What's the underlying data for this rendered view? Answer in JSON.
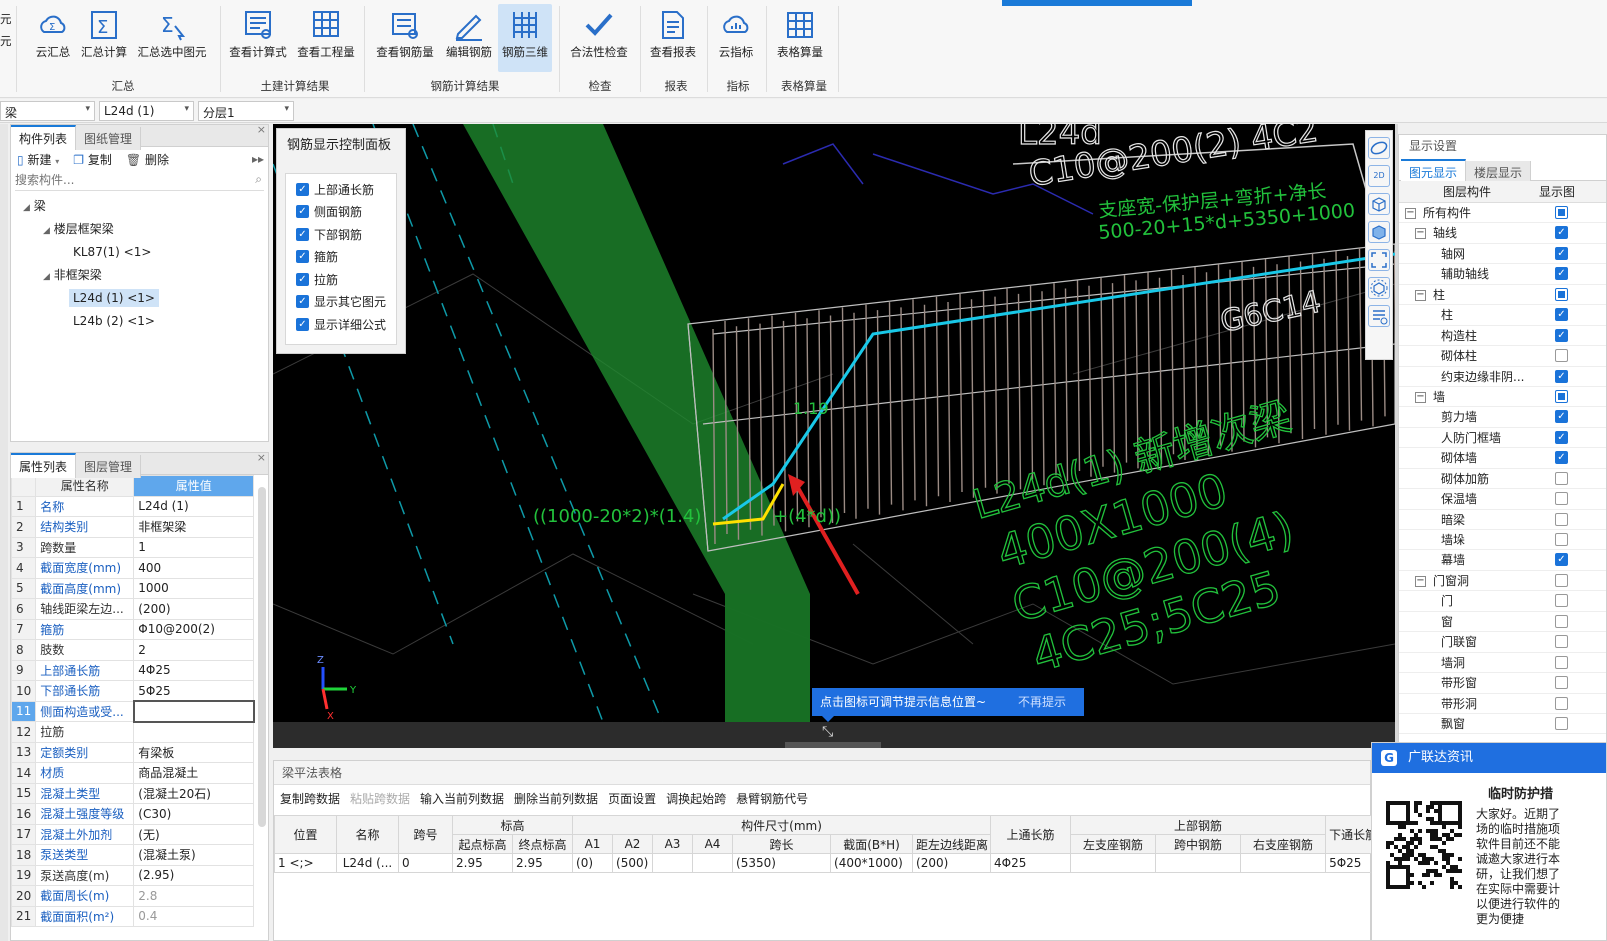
{
  "ribbon": {
    "left_cut": [
      "元",
      "元"
    ],
    "buttons": [
      {
        "label": "云汇总",
        "icon": "cloud-sum-icon"
      },
      {
        "label": "汇总计算",
        "icon": "sigma-icon"
      },
      {
        "label": "汇总选中图元",
        "icon": "sigma-select-icon"
      },
      {
        "label": "查看计算式",
        "icon": "view-formula-icon"
      },
      {
        "label": "查看工程量",
        "icon": "view-quantity-icon"
      },
      {
        "label": "查看钢筋量",
        "icon": "view-rebar-icon"
      },
      {
        "label": "编辑钢筋",
        "icon": "edit-rebar-icon"
      },
      {
        "label": "钢筋三维",
        "icon": "rebar-3d-icon"
      },
      {
        "label": "合法性检查",
        "icon": "check-icon"
      },
      {
        "label": "查看报表",
        "icon": "report-icon"
      },
      {
        "label": "云指标",
        "icon": "cloud-index-icon"
      },
      {
        "label": "表格算量",
        "icon": "table-calc-icon"
      }
    ],
    "groups": [
      "汇总",
      "土建计算结果",
      "钢筋计算结果",
      "检查",
      "报表",
      "指标",
      "表格算量"
    ]
  },
  "selectors": {
    "type": "梁",
    "name": "L24d (1)",
    "floor": "分层1"
  },
  "component_panel": {
    "tabs": [
      "构件列表",
      "图纸管理"
    ],
    "toolbar": {
      "new": "新建",
      "copy": "复制",
      "delete": "删除"
    },
    "search_placeholder": "搜索构件...",
    "tree": {
      "root": "梁",
      "group1": "楼层框架梁",
      "item1": "KL87(1) <1>",
      "group2": "非框架梁",
      "item2": "L24d (1)  <1>",
      "item3": "L24b (2) <1>"
    }
  },
  "property_panel": {
    "tabs": [
      "属性列表",
      "图层管理"
    ],
    "col_name": "属性名称",
    "col_value": "属性值",
    "rows": [
      {
        "n": "1",
        "k": "名称",
        "v": "L24d  (1)"
      },
      {
        "n": "2",
        "k": "结构类别",
        "v": "非框架梁"
      },
      {
        "n": "3",
        "k": "跨数量",
        "v": "1"
      },
      {
        "n": "4",
        "k": "截面宽度(mm)",
        "v": "400"
      },
      {
        "n": "5",
        "k": "截面高度(mm)",
        "v": "1000"
      },
      {
        "n": "6",
        "k": "轴线距梁左边...",
        "v": "(200)"
      },
      {
        "n": "7",
        "k": "箍筋",
        "v": "Φ10@200(2)"
      },
      {
        "n": "8",
        "k": "肢数",
        "v": "2"
      },
      {
        "n": "9",
        "k": "上部通长筋",
        "v": "4Φ25"
      },
      {
        "n": "10",
        "k": "下部通长筋",
        "v": "5Φ25"
      },
      {
        "n": "11",
        "k": "侧面构造或受...",
        "v": ""
      },
      {
        "n": "12",
        "k": "拉筋",
        "v": ""
      },
      {
        "n": "13",
        "k": "定额类别",
        "v": "有梁板"
      },
      {
        "n": "14",
        "k": "材质",
        "v": "商品混凝土"
      },
      {
        "n": "15",
        "k": "混凝土类型",
        "v": "(混凝土20石)"
      },
      {
        "n": "16",
        "k": "混凝土强度等级",
        "v": "(C30)"
      },
      {
        "n": "17",
        "k": "混凝土外加剂",
        "v": "(无)"
      },
      {
        "n": "18",
        "k": "泵送类型",
        "v": "(混凝土泵)"
      },
      {
        "n": "19",
        "k": "泵送高度(m)",
        "v": "(2.95)"
      },
      {
        "n": "20",
        "k": "截面周长(m)",
        "v": "2.8"
      },
      {
        "n": "21",
        "k": "截面面积(m²)",
        "v": "0.4"
      }
    ]
  },
  "rebar_control": {
    "title": "钢筋显示控制面板",
    "items": [
      "上部通长筋",
      "侧面钢筋",
      "下部钢筋",
      "箍筋",
      "拉筋",
      "显示其它图元",
      "显示详细公式"
    ]
  },
  "viewport": {
    "t1": "L24d",
    "t2": "C10@200(2) 4C2",
    "t3": "支座宽-保护层+弯折+净长",
    "t4": "500-20+15*d+5350+1000",
    "t5": "G6C14",
    "t6": "L24d(1) 新增次梁",
    "t7": "400X1000",
    "t8": "C10@200(4)",
    "t9": "4C25;5C25",
    "t10": "((1000-20*2)*(1.4)",
    "t11": "+(4*d))",
    "t12": "1.19",
    "accent_cyan": "#19c8e8",
    "accent_green": "#22c13c"
  },
  "tip": {
    "text": "点击图标可调节提示信息位置~",
    "dismiss": "不再提示"
  },
  "grid": {
    "title": "梁平法表格",
    "toolbar": [
      "复制跨数据",
      "粘贴跨数据",
      "输入当前列数据",
      "删除当前列数据",
      "页面设置",
      "调换起始跨",
      "悬臂钢筋代号"
    ],
    "h": {
      "pos": "位置",
      "name": "名称",
      "span": "跨号",
      "elev": "标高",
      "start": "起点标高",
      "end": "终点标高",
      "size": "构件尺寸(mm)",
      "a1": "A1",
      "a2": "A2",
      "a3": "A3",
      "a4": "A4",
      "spanlen": "跨长",
      "sect": "截面(B*H)",
      "left": "距左边线距离",
      "top_cont": "上通长筋",
      "top_rebar": "上部钢筋",
      "left_sup": "左支座钢筋",
      "mid": "跨中钢筋",
      "right_sup": "右支座钢筋",
      "bot_cont": "下通长筋"
    },
    "row": {
      "idx": "1",
      "pos": "<;>",
      "name": "L24d (...",
      "span": "0",
      "start": "2.95",
      "end": "2.95",
      "a1": "(0)",
      "a2": "(500)",
      "a3": "",
      "a4": "",
      "spanlen": "(5350)",
      "sect": "(400*1000)",
      "left": "(200)",
      "top_cont": "4Φ25",
      "left_sup": "",
      "mid": "",
      "right_sup": "",
      "bot_cont": "5Φ25"
    }
  },
  "display_settings": {
    "title": "显示设置",
    "tabs": [
      "图元显示",
      "楼层显示"
    ],
    "col1": "图层构件",
    "col2": "显示图",
    "rows": [
      {
        "label": "所有构件",
        "lvl": 0,
        "exp": "−",
        "st": "part"
      },
      {
        "label": "轴线",
        "lvl": 1,
        "exp": "−",
        "st": "on"
      },
      {
        "label": "轴网",
        "lvl": 2,
        "st": "on"
      },
      {
        "label": "辅助轴线",
        "lvl": 2,
        "st": "on"
      },
      {
        "label": "柱",
        "lvl": 1,
        "exp": "−",
        "st": "part"
      },
      {
        "label": "柱",
        "lvl": 2,
        "st": "on"
      },
      {
        "label": "构造柱",
        "lvl": 2,
        "st": "on"
      },
      {
        "label": "砌体柱",
        "lvl": 2,
        "st": "off"
      },
      {
        "label": "约束边缘非阴...",
        "lvl": 2,
        "st": "on"
      },
      {
        "label": "墙",
        "lvl": 1,
        "exp": "−",
        "st": "part"
      },
      {
        "label": "剪力墙",
        "lvl": 2,
        "st": "on"
      },
      {
        "label": "人防门框墙",
        "lvl": 2,
        "st": "on"
      },
      {
        "label": "砌体墙",
        "lvl": 2,
        "st": "on"
      },
      {
        "label": "砌体加筋",
        "lvl": 2,
        "st": "off"
      },
      {
        "label": "保温墙",
        "lvl": 2,
        "st": "off"
      },
      {
        "label": "暗梁",
        "lvl": 2,
        "st": "off"
      },
      {
        "label": "墙垛",
        "lvl": 2,
        "st": "off"
      },
      {
        "label": "幕墙",
        "lvl": 2,
        "st": "on"
      },
      {
        "label": "门窗洞",
        "lvl": 1,
        "exp": "−",
        "st": "off"
      },
      {
        "label": "门",
        "lvl": 2,
        "st": "off"
      },
      {
        "label": "窗",
        "lvl": 2,
        "st": "off"
      },
      {
        "label": "门联窗",
        "lvl": 2,
        "st": "off"
      },
      {
        "label": "墙洞",
        "lvl": 2,
        "st": "off"
      },
      {
        "label": "带形窗",
        "lvl": 2,
        "st": "off"
      },
      {
        "label": "带形洞",
        "lvl": 2,
        "st": "off"
      },
      {
        "label": "飘窗",
        "lvl": 2,
        "st": "off"
      }
    ]
  },
  "news": {
    "title": "广联达资讯",
    "headline": "临时防护措",
    "lines": [
      "大家好。近期了",
      "场的临时措施项",
      "软件目前还不能",
      "诚邀大家进行本",
      "研，让我们想了",
      "在实际中需要计",
      "以便进行软件的",
      "更为便捷"
    ]
  }
}
